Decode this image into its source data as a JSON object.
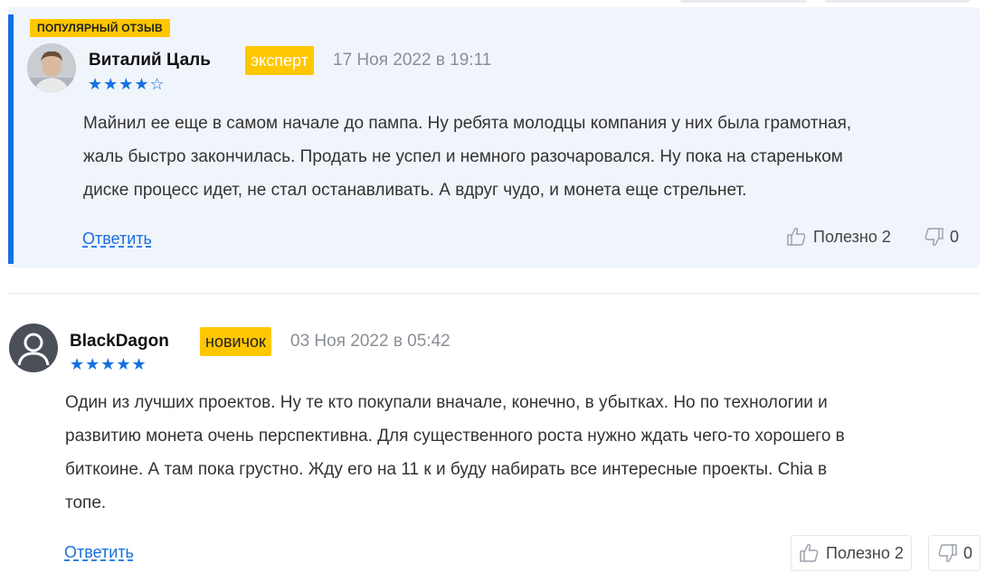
{
  "reviews": [
    {
      "tag": "ПОПУЛЯРНЫЙ ОТЗЫВ",
      "author": "Виталий Цаль",
      "badge": "эксперт",
      "date": "17 Ноя 2022 в 19:11",
      "rating": 4,
      "rating_max": 5,
      "stars": "★★★★☆",
      "text_lines": [
        "Майнил ее еще в самом начале до пампа. Ну ребята молодцы компания у них была грамотная,",
        "жаль быстро закончилась. Продать не успел и немного разочаровался. Ну пока на стареньком",
        "диске процесс идет, не стал останавливать. А вдруг чудо, и монета еще стрельнет."
      ],
      "reply_label": "Ответить",
      "helpful_label": "Полезно 2",
      "unhelpful_count": "0"
    },
    {
      "author": "BlackDagon",
      "badge": "новичок",
      "date": "03 Ноя 2022 в 05:42",
      "rating": 5,
      "rating_max": 5,
      "stars": "★★★★★",
      "text_lines": [
        "Один из лучших проектов. Ну те кто покупали вначале, конечно, в убытках. Но по технологии и",
        "развитию монета очень перспективна. Для существенного роста нужно ждать чего-то хорошего в",
        "биткоине. А там пока грустно. Жду его на 11 к и буду набирать все интересные проекты. Chia в",
        "топе."
      ],
      "reply_label": "Ответить",
      "helpful_label": "Полезно 2",
      "unhelpful_count": "0"
    }
  ],
  "colors": {
    "accent": "#1670e0",
    "badge_bg": "#ffc700",
    "highlight_bg": "#f0f4fb",
    "date_text": "#8a8f96"
  },
  "icons": {
    "avatar_1": "user-photo",
    "avatar_2": "default-user-icon",
    "helpful": "thumbs-up-icon",
    "unhelpful": "thumbs-down-icon"
  }
}
